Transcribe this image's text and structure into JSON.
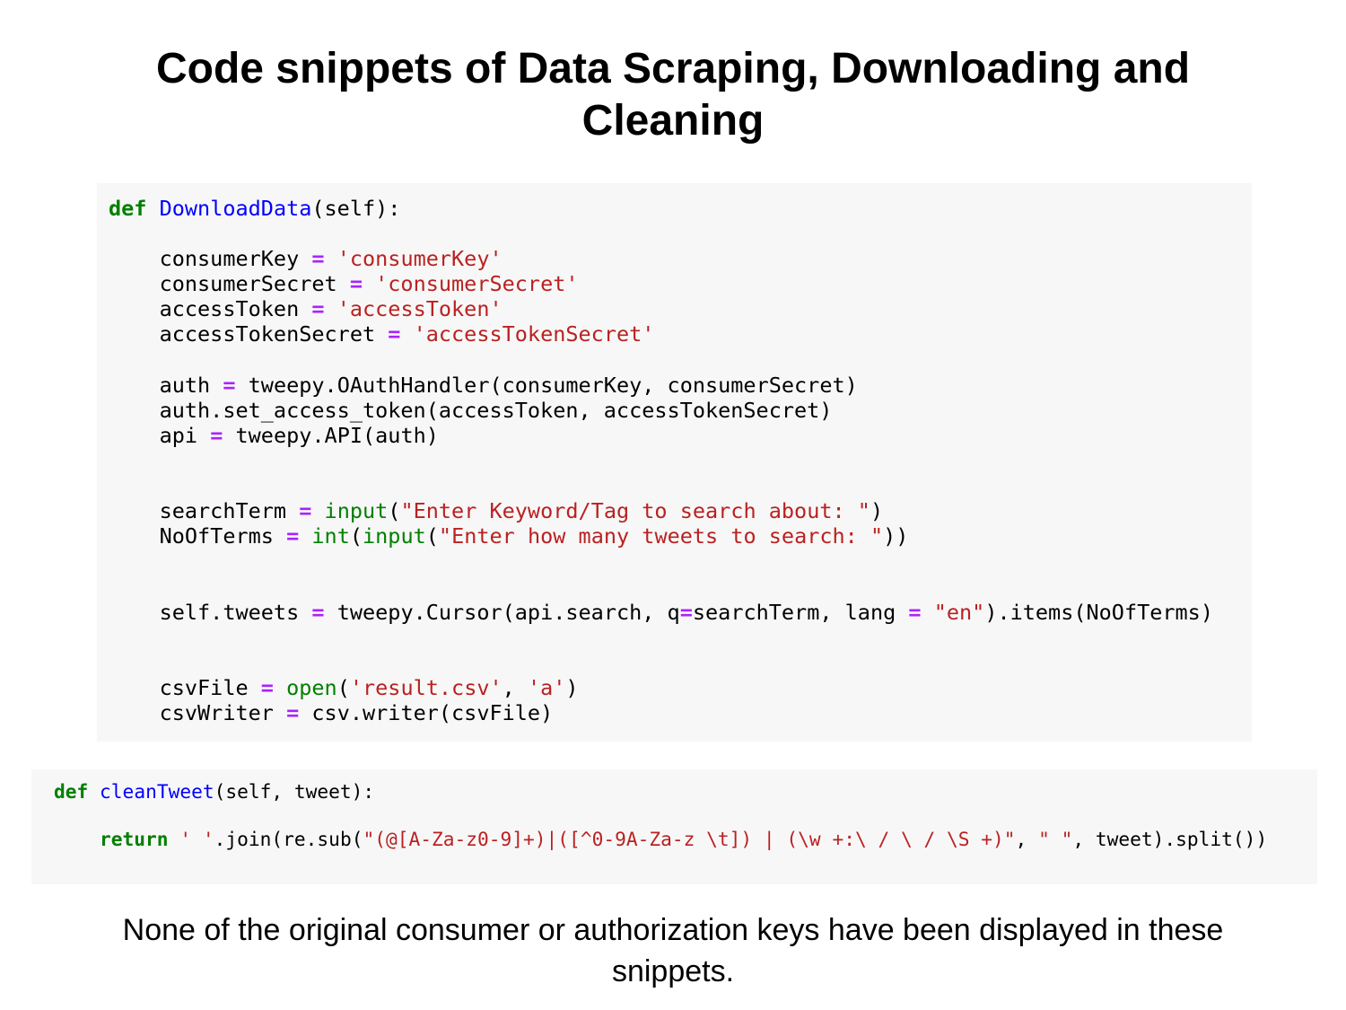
{
  "slide": {
    "title": "Code snippets of Data Scraping, Downloading and Cleaning",
    "footnote": "None of the original consumer or authorization keys have been displayed in these snippets."
  },
  "code_blocks": {
    "download": {
      "def_keyword": "def",
      "function_name": "DownloadData",
      "signature_rest": "(self):",
      "lines": {
        "consumer_key": {
          "name": "consumerKey",
          "op": "=",
          "value": "'consumerKey'"
        },
        "consumer_secret": {
          "name": "consumerSecret",
          "op": "=",
          "value": "'consumerSecret'"
        },
        "access_token": {
          "name": "accessToken",
          "op": "=",
          "value": "'accessToken'"
        },
        "access_token_secret": {
          "name": "accessTokenSecret",
          "op": "=",
          "value": "'accessTokenSecret'"
        },
        "auth": {
          "name": "auth",
          "op": "=",
          "rest": "tweepy.OAuthHandler(consumerKey, consumerSecret)"
        },
        "set_token": {
          "text": "auth.set_access_token(accessToken, accessTokenSecret)"
        },
        "api": {
          "name": "api",
          "op": "=",
          "rest": "tweepy.API(auth)"
        },
        "search_term": {
          "name": "searchTerm",
          "op": "=",
          "builtin": "input",
          "open": "(",
          "string": "\"Enter Keyword/Tag to search about: \"",
          "close": ")"
        },
        "no_of_terms": {
          "name": "NoOfTerms",
          "op": "=",
          "builtin1": "int",
          "open1": "(",
          "builtin2": "input",
          "open2": "(",
          "string": "\"Enter how many tweets to search: \"",
          "close": "))"
        },
        "tweets": {
          "name": "self.tweets",
          "op": "=",
          "rest1": "tweepy.Cursor(api.search, q",
          "op2": "=",
          "rest2": "searchTerm, lang ",
          "op3": "=",
          "space": " ",
          "string": "\"en\"",
          "rest3": ").items(NoOfTerms)"
        },
        "csv_file": {
          "name": "csvFile",
          "op": "=",
          "builtin": "open",
          "open": "(",
          "string1": "'result.csv'",
          "sep": ", ",
          "string2": "'a'",
          "close": ")"
        },
        "csv_writer": {
          "name": "csvWriter",
          "op": "=",
          "rest": "csv.writer(csvFile)"
        }
      }
    },
    "clean": {
      "def_keyword": "def",
      "function_name": "cleanTweet",
      "signature_rest": "(self, tweet):",
      "return_keyword": "return",
      "return_string1": "' '",
      "return_part1": ".join(re.sub(",
      "return_regex": "\"(@[A-Za-z0-9]+)|([^0-9A-Za-z \\t]) | (\\w +:\\ / \\ / \\S +)\"",
      "return_sep": ", ",
      "return_string2": "\" \"",
      "return_part2": ", tweet).split())"
    }
  }
}
